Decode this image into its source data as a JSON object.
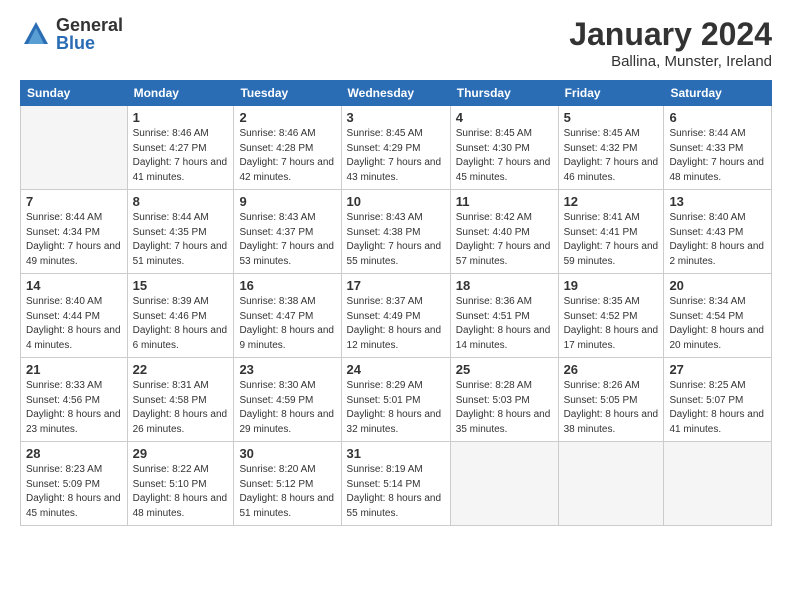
{
  "header": {
    "logo_general": "General",
    "logo_blue": "Blue",
    "title": "January 2024",
    "subtitle": "Ballina, Munster, Ireland"
  },
  "weekdays": [
    "Sunday",
    "Monday",
    "Tuesday",
    "Wednesday",
    "Thursday",
    "Friday",
    "Saturday"
  ],
  "weeks": [
    [
      {
        "day": "",
        "empty": true
      },
      {
        "day": "1",
        "sunrise": "Sunrise: 8:46 AM",
        "sunset": "Sunset: 4:27 PM",
        "daylight": "Daylight: 7 hours and 41 minutes."
      },
      {
        "day": "2",
        "sunrise": "Sunrise: 8:46 AM",
        "sunset": "Sunset: 4:28 PM",
        "daylight": "Daylight: 7 hours and 42 minutes."
      },
      {
        "day": "3",
        "sunrise": "Sunrise: 8:45 AM",
        "sunset": "Sunset: 4:29 PM",
        "daylight": "Daylight: 7 hours and 43 minutes."
      },
      {
        "day": "4",
        "sunrise": "Sunrise: 8:45 AM",
        "sunset": "Sunset: 4:30 PM",
        "daylight": "Daylight: 7 hours and 45 minutes."
      },
      {
        "day": "5",
        "sunrise": "Sunrise: 8:45 AM",
        "sunset": "Sunset: 4:32 PM",
        "daylight": "Daylight: 7 hours and 46 minutes."
      },
      {
        "day": "6",
        "sunrise": "Sunrise: 8:44 AM",
        "sunset": "Sunset: 4:33 PM",
        "daylight": "Daylight: 7 hours and 48 minutes."
      }
    ],
    [
      {
        "day": "7",
        "sunrise": "Sunrise: 8:44 AM",
        "sunset": "Sunset: 4:34 PM",
        "daylight": "Daylight: 7 hours and 49 minutes."
      },
      {
        "day": "8",
        "sunrise": "Sunrise: 8:44 AM",
        "sunset": "Sunset: 4:35 PM",
        "daylight": "Daylight: 7 hours and 51 minutes."
      },
      {
        "day": "9",
        "sunrise": "Sunrise: 8:43 AM",
        "sunset": "Sunset: 4:37 PM",
        "daylight": "Daylight: 7 hours and 53 minutes."
      },
      {
        "day": "10",
        "sunrise": "Sunrise: 8:43 AM",
        "sunset": "Sunset: 4:38 PM",
        "daylight": "Daylight: 7 hours and 55 minutes."
      },
      {
        "day": "11",
        "sunrise": "Sunrise: 8:42 AM",
        "sunset": "Sunset: 4:40 PM",
        "daylight": "Daylight: 7 hours and 57 minutes."
      },
      {
        "day": "12",
        "sunrise": "Sunrise: 8:41 AM",
        "sunset": "Sunset: 4:41 PM",
        "daylight": "Daylight: 7 hours and 59 minutes."
      },
      {
        "day": "13",
        "sunrise": "Sunrise: 8:40 AM",
        "sunset": "Sunset: 4:43 PM",
        "daylight": "Daylight: 8 hours and 2 minutes."
      }
    ],
    [
      {
        "day": "14",
        "sunrise": "Sunrise: 8:40 AM",
        "sunset": "Sunset: 4:44 PM",
        "daylight": "Daylight: 8 hours and 4 minutes."
      },
      {
        "day": "15",
        "sunrise": "Sunrise: 8:39 AM",
        "sunset": "Sunset: 4:46 PM",
        "daylight": "Daylight: 8 hours and 6 minutes."
      },
      {
        "day": "16",
        "sunrise": "Sunrise: 8:38 AM",
        "sunset": "Sunset: 4:47 PM",
        "daylight": "Daylight: 8 hours and 9 minutes."
      },
      {
        "day": "17",
        "sunrise": "Sunrise: 8:37 AM",
        "sunset": "Sunset: 4:49 PM",
        "daylight": "Daylight: 8 hours and 12 minutes."
      },
      {
        "day": "18",
        "sunrise": "Sunrise: 8:36 AM",
        "sunset": "Sunset: 4:51 PM",
        "daylight": "Daylight: 8 hours and 14 minutes."
      },
      {
        "day": "19",
        "sunrise": "Sunrise: 8:35 AM",
        "sunset": "Sunset: 4:52 PM",
        "daylight": "Daylight: 8 hours and 17 minutes."
      },
      {
        "day": "20",
        "sunrise": "Sunrise: 8:34 AM",
        "sunset": "Sunset: 4:54 PM",
        "daylight": "Daylight: 8 hours and 20 minutes."
      }
    ],
    [
      {
        "day": "21",
        "sunrise": "Sunrise: 8:33 AM",
        "sunset": "Sunset: 4:56 PM",
        "daylight": "Daylight: 8 hours and 23 minutes."
      },
      {
        "day": "22",
        "sunrise": "Sunrise: 8:31 AM",
        "sunset": "Sunset: 4:58 PM",
        "daylight": "Daylight: 8 hours and 26 minutes."
      },
      {
        "day": "23",
        "sunrise": "Sunrise: 8:30 AM",
        "sunset": "Sunset: 4:59 PM",
        "daylight": "Daylight: 8 hours and 29 minutes."
      },
      {
        "day": "24",
        "sunrise": "Sunrise: 8:29 AM",
        "sunset": "Sunset: 5:01 PM",
        "daylight": "Daylight: 8 hours and 32 minutes."
      },
      {
        "day": "25",
        "sunrise": "Sunrise: 8:28 AM",
        "sunset": "Sunset: 5:03 PM",
        "daylight": "Daylight: 8 hours and 35 minutes."
      },
      {
        "day": "26",
        "sunrise": "Sunrise: 8:26 AM",
        "sunset": "Sunset: 5:05 PM",
        "daylight": "Daylight: 8 hours and 38 minutes."
      },
      {
        "day": "27",
        "sunrise": "Sunrise: 8:25 AM",
        "sunset": "Sunset: 5:07 PM",
        "daylight": "Daylight: 8 hours and 41 minutes."
      }
    ],
    [
      {
        "day": "28",
        "sunrise": "Sunrise: 8:23 AM",
        "sunset": "Sunset: 5:09 PM",
        "daylight": "Daylight: 8 hours and 45 minutes."
      },
      {
        "day": "29",
        "sunrise": "Sunrise: 8:22 AM",
        "sunset": "Sunset: 5:10 PM",
        "daylight": "Daylight: 8 hours and 48 minutes."
      },
      {
        "day": "30",
        "sunrise": "Sunrise: 8:20 AM",
        "sunset": "Sunset: 5:12 PM",
        "daylight": "Daylight: 8 hours and 51 minutes."
      },
      {
        "day": "31",
        "sunrise": "Sunrise: 8:19 AM",
        "sunset": "Sunset: 5:14 PM",
        "daylight": "Daylight: 8 hours and 55 minutes."
      },
      {
        "day": "",
        "empty": true
      },
      {
        "day": "",
        "empty": true
      },
      {
        "day": "",
        "empty": true
      }
    ]
  ]
}
